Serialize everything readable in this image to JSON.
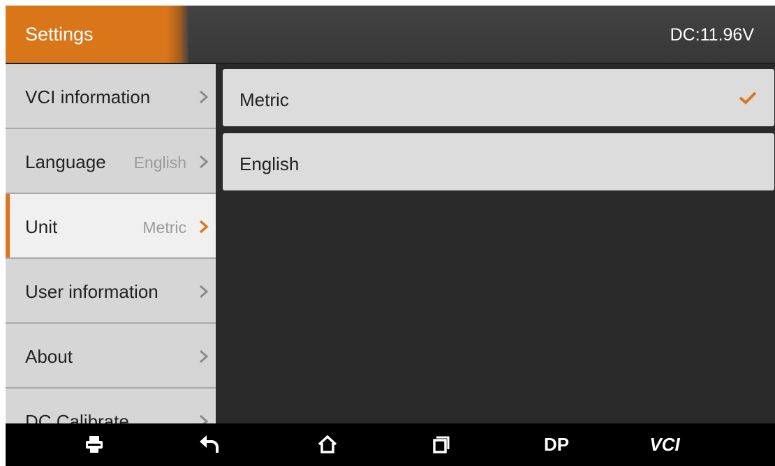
{
  "header": {
    "title": "Settings",
    "voltage": "DC:11.96V"
  },
  "sidebar": {
    "items": [
      {
        "label": "VCI information",
        "value": "",
        "active": false
      },
      {
        "label": "Language",
        "value": "English",
        "active": false
      },
      {
        "label": "Unit",
        "value": "Metric",
        "active": true
      },
      {
        "label": "User information",
        "value": "",
        "active": false
      },
      {
        "label": "About",
        "value": "",
        "active": false
      },
      {
        "label": "DC Calibrate",
        "value": "",
        "active": false
      }
    ]
  },
  "content": {
    "options": [
      {
        "label": "Metric",
        "selected": true
      },
      {
        "label": "English",
        "selected": false
      }
    ]
  },
  "navbar": {
    "buttons": [
      {
        "icon": "print-icon"
      },
      {
        "icon": "back-icon"
      },
      {
        "icon": "home-icon"
      },
      {
        "icon": "recent-apps-icon"
      },
      {
        "label": "DP"
      },
      {
        "label": "VCI"
      }
    ]
  },
  "colors": {
    "accent": "#e0741c",
    "header_bg": "#3d3d3d",
    "content_bg": "#2a2a2a",
    "sidebar_bg": "#d6d6d6",
    "active_item_bg": "#f0f0f0"
  }
}
